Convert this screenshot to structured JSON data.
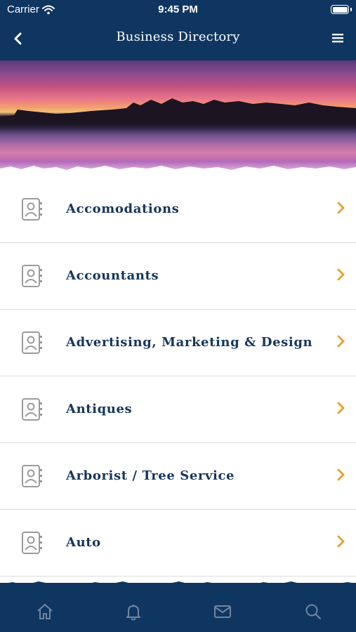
{
  "status_bar": {
    "carrier": "Carrier",
    "time": "9:45 PM"
  },
  "nav": {
    "title": "Business Directory",
    "back_icon": "chevron-left-icon",
    "menu_icon": "hamburger-menu-icon"
  },
  "banner": {
    "description_icon": "sunset-lake-photo"
  },
  "directory": {
    "items": [
      {
        "label": "Accomodations",
        "icon": "contact-book-icon"
      },
      {
        "label": "Accountants",
        "icon": "contact-book-icon"
      },
      {
        "label": "Advertising, Marketing & Design",
        "icon": "contact-book-icon"
      },
      {
        "label": "Antiques",
        "icon": "contact-book-icon"
      },
      {
        "label": "Arborist / Tree Service",
        "icon": "contact-book-icon"
      },
      {
        "label": "Auto",
        "icon": "contact-book-icon"
      }
    ]
  },
  "tab_bar": {
    "tabs": [
      {
        "icon": "home-icon"
      },
      {
        "icon": "bell-icon"
      },
      {
        "icon": "mail-icon"
      },
      {
        "icon": "search-icon"
      }
    ]
  },
  "colors": {
    "nav_background": "#0f3660",
    "label_text": "#16365c",
    "chevron_accent": "#e2a43a",
    "icon_gray": "#9a9a9a",
    "tab_icon": "#6f86a3"
  }
}
